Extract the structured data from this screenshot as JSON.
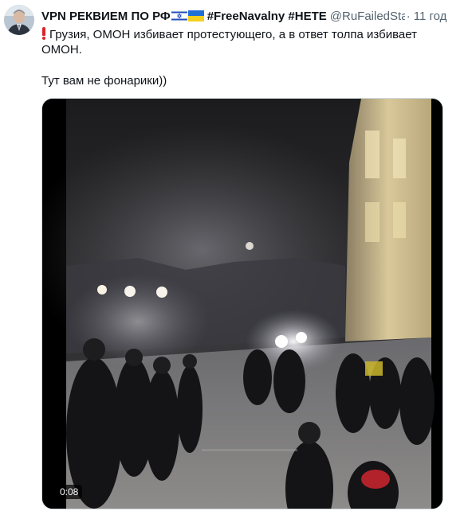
{
  "tweet": {
    "author_name": "VPN РЕКВИЕМ ПО РФ",
    "flags": [
      "israel-flag-icon",
      "ukraine-flag-icon"
    ],
    "hashtags": "#FreeNavalny #НЕТЕ",
    "handle": "@RuFailedState",
    "separator": "·",
    "time": "11 год",
    "text_line1": "Грузия, ОМОН избивает протестующего, а в ответ толпа избивает",
    "text_line2": "ОМОН.",
    "text_line3": "Тут вам не фонарики))",
    "leading_icon": "exclamation-mark-icon"
  },
  "video": {
    "duration": "0:08"
  },
  "colors": {
    "text_primary": "#0f1419",
    "text_secondary": "#536471",
    "exclamation": "#d9242b",
    "media_border": "#cfd9de"
  }
}
